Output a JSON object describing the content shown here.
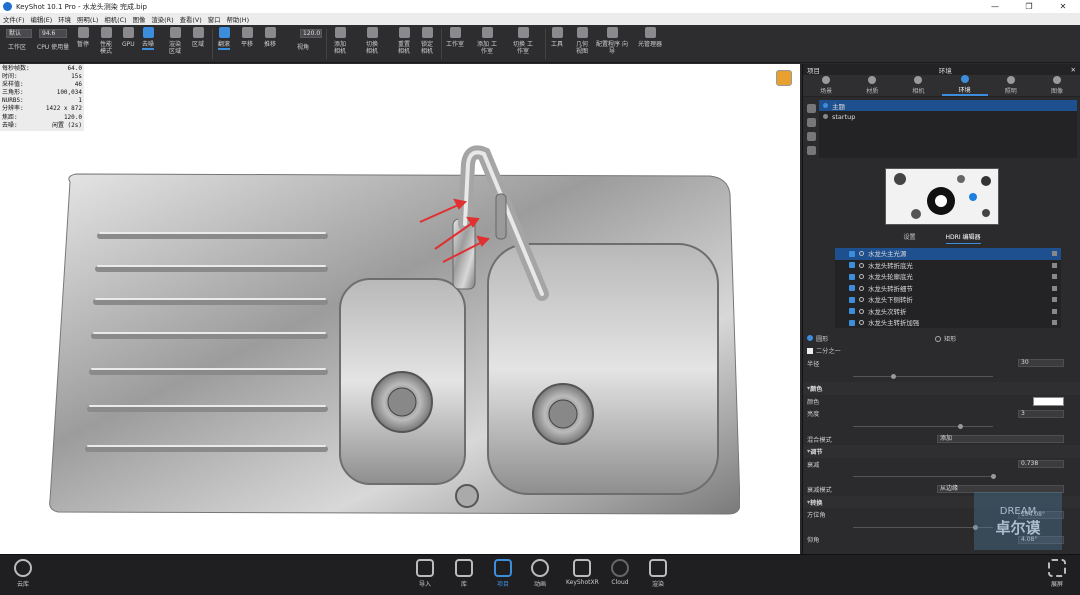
{
  "titlebar": {
    "title": "KeyShot 10.1 Pro  - 水龙头测染 完成.bip",
    "minimize": "—",
    "maximize": "❐",
    "close": "✕"
  },
  "menu": [
    "文件(F)",
    "编辑(E)",
    "环境",
    "照明(L)",
    "相机(C)",
    "图像",
    "渲染(R)",
    "查看(V)",
    "窗口",
    "帮助(H)"
  ],
  "toolbar": {
    "workspace_select": "默认",
    "zoom_value": "94.6",
    "fov_value": "120.0",
    "items": [
      {
        "label": "工作区"
      },
      {
        "label": "CPU 使用量"
      },
      {
        "label": "暂停"
      },
      {
        "label": "性能 模式"
      },
      {
        "label": "GPU"
      },
      {
        "label": "去噪"
      },
      {
        "label": "渲染 区域"
      },
      {
        "label": "区域"
      },
      {
        "label": "翻滚"
      },
      {
        "label": "平移"
      },
      {
        "label": "推移"
      },
      {
        "label": "视角"
      },
      {
        "label": "添加 相机"
      },
      {
        "label": "切换 相机"
      },
      {
        "label": "重置 相机"
      },
      {
        "label": "锁定 相机"
      },
      {
        "label": "工作室"
      },
      {
        "label": "添加 工作室"
      },
      {
        "label": "切换 工作室"
      },
      {
        "label": "工具"
      },
      {
        "label": "几何 视图"
      },
      {
        "label": "配置程序 向导"
      },
      {
        "label": "光管理器"
      }
    ]
  },
  "stats": [
    {
      "k": "每秒帧数:",
      "v": "64.0"
    },
    {
      "k": "时间:",
      "v": "15s"
    },
    {
      "k": "采样值:",
      "v": "46"
    },
    {
      "k": "三角形:",
      "v": "100,034"
    },
    {
      "k": "NURBS:",
      "v": "1"
    },
    {
      "k": "分辨率:",
      "v": "1422 x 872"
    },
    {
      "k": "焦距:",
      "v": "120.0"
    },
    {
      "k": "去噪:",
      "v": "闲置 (2s)"
    }
  ],
  "panel": {
    "left_title": "项目",
    "title": "环境",
    "tabs": [
      {
        "label": "场景"
      },
      {
        "label": "材质"
      },
      {
        "label": "相机"
      },
      {
        "label": "环境"
      },
      {
        "label": "照明"
      },
      {
        "label": "图像"
      }
    ],
    "environments": [
      "主题",
      "startup"
    ],
    "subtabs": [
      "设置",
      "HDRI 编辑器"
    ],
    "pins": [
      "水龙头主光源",
      "水龙头转折底光",
      "水龙头轮廓底光",
      "水龙头转折细节",
      "水龙头下侧转折",
      "水龙头次转折",
      "水龙头主转折加强"
    ],
    "shape": {
      "circle": "圆形",
      "rect": "矩形",
      "half": "二分之一"
    },
    "radius_label": "半径",
    "radius_value": "30",
    "color_section": "颜色",
    "color_label": "颜色",
    "color_hex": "#ffffff",
    "brightness_label": "亮度",
    "brightness_value": "3",
    "blend_label": "混合模式",
    "blend_value": "添加",
    "adjust_section": "调节",
    "falloff_label": "衰减",
    "falloff_value": "0.738",
    "falloff_mode_label": "衰减模式",
    "falloff_mode_value": "从边缘",
    "transform_section": "转换",
    "azimuth_label": "方位角",
    "azimuth_value": "104.08°",
    "height_label": "仰角",
    "height_value": "4.08°"
  },
  "watermark": {
    "line1": "DREAM",
    "line2": "卓尔谟"
  },
  "bottombar": {
    "cloud": "云库",
    "items": [
      "导入",
      "库",
      "项目",
      "动画",
      "KeyShotXR",
      "Cloud",
      "渲染"
    ],
    "expand": "展屏"
  }
}
